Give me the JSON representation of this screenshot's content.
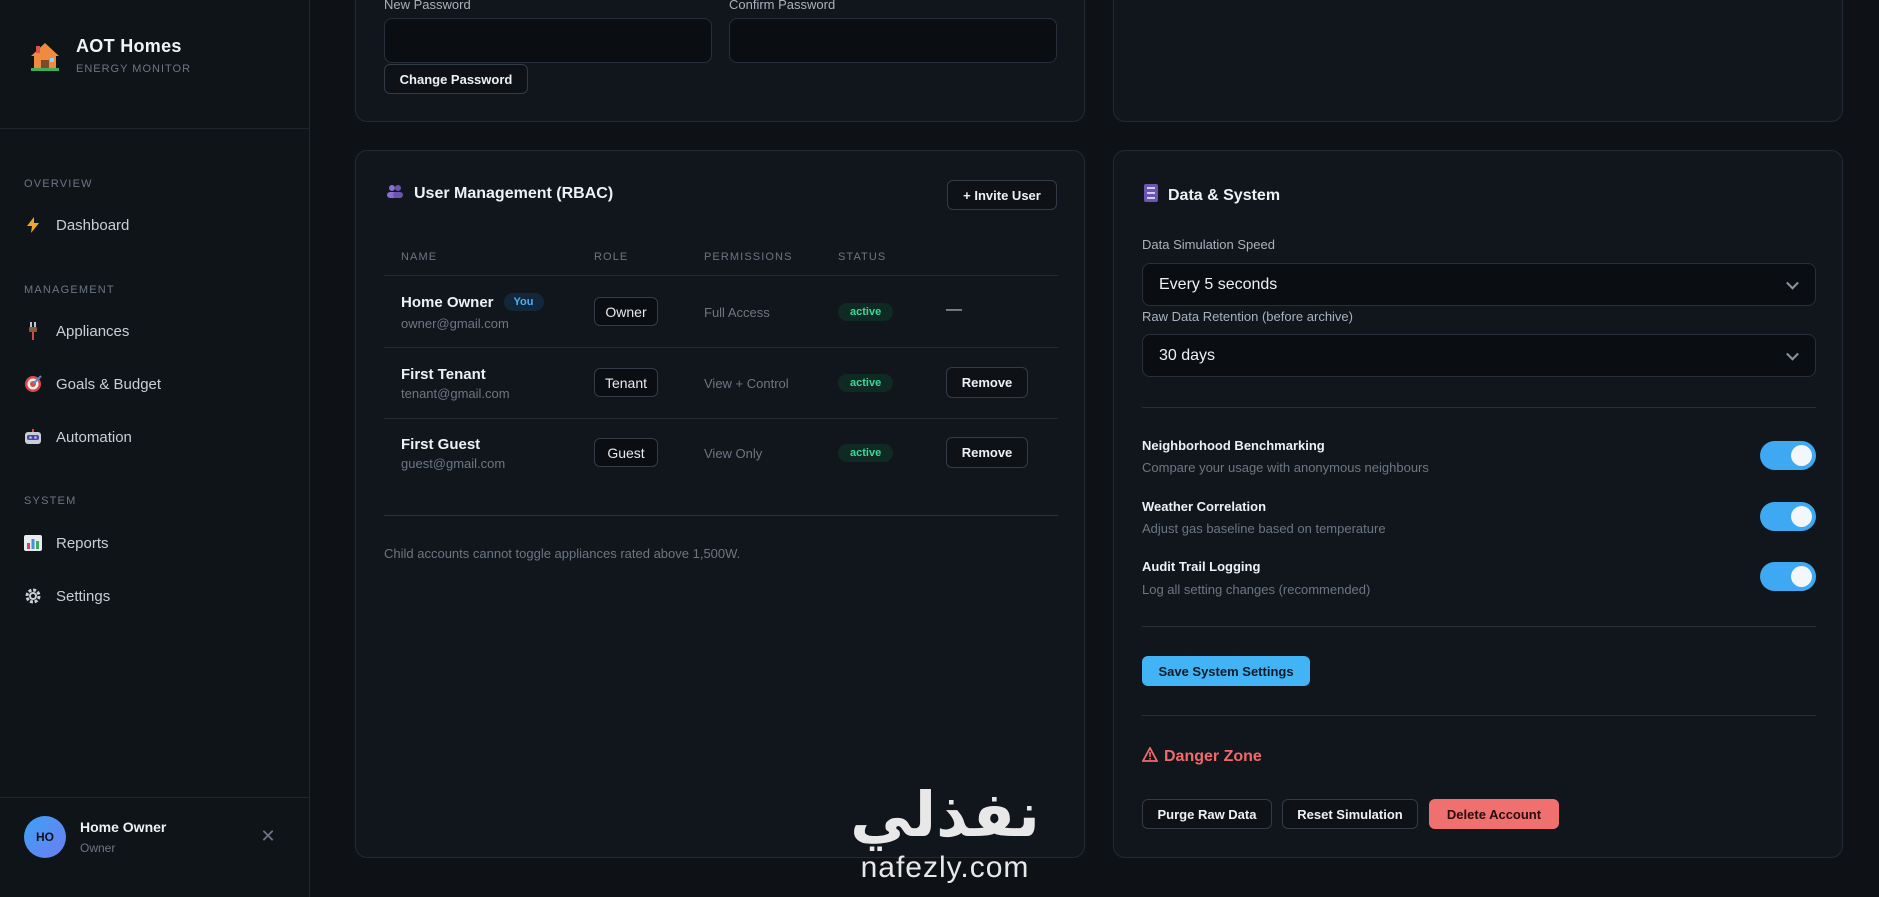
{
  "brand": {
    "title": "AOT Homes",
    "subtitle": "ENERGY MONITOR",
    "icon": "house-icon"
  },
  "sidebar": {
    "sections": {
      "overview": "OVERVIEW",
      "management": "MANAGEMENT",
      "system": "SYSTEM"
    },
    "items": [
      {
        "label": "Dashboard",
        "icon": "lightning-icon"
      },
      {
        "label": "Appliances",
        "icon": "plug-icon"
      },
      {
        "label": "Goals & Budget",
        "icon": "target-icon"
      },
      {
        "label": "Automation",
        "icon": "robot-icon"
      },
      {
        "label": "Reports",
        "icon": "bar-chart-icon"
      },
      {
        "label": "Settings",
        "icon": "gear-icon"
      }
    ],
    "user": {
      "initials": "HO",
      "name": "Home Owner",
      "role": "Owner"
    }
  },
  "password": {
    "new_label": "New Password",
    "confirm_label": "Confirm Password",
    "new_value": "",
    "confirm_value": "",
    "change_button": "Change Password"
  },
  "users": {
    "title": "User Management (RBAC)",
    "invite_button": "+ Invite User",
    "columns": [
      "NAME",
      "ROLE",
      "PERMISSIONS",
      "STATUS"
    ],
    "rows": [
      {
        "name": "Home Owner",
        "badge": "You",
        "email": "owner@gmail.com",
        "role": "Owner",
        "permissions": "Full Access",
        "status": "active",
        "action": "—"
      },
      {
        "name": "First Tenant",
        "email": "tenant@gmail.com",
        "role": "Tenant",
        "permissions": "View + Control",
        "status": "active",
        "action": "Remove"
      },
      {
        "name": "First Guest",
        "email": "guest@gmail.com",
        "role": "Guest",
        "permissions": "View Only",
        "status": "active",
        "action": "Remove"
      }
    ],
    "note": "Child accounts cannot toggle appliances rated above 1,500W."
  },
  "system": {
    "title": "Data & System",
    "speed_label": "Data Simulation Speed",
    "speed_value": "Every 5 seconds",
    "retention_label": "Raw Data Retention (before archive)",
    "retention_value": "30 days",
    "options": [
      {
        "title": "Neighborhood Benchmarking",
        "desc": "Compare your usage with anonymous neighbours",
        "on": true
      },
      {
        "title": "Weather Correlation",
        "desc": "Adjust gas baseline based on temperature",
        "on": true
      },
      {
        "title": "Audit Trail Logging",
        "desc": "Log all setting changes (recommended)",
        "on": true
      }
    ],
    "save_button": "Save System Settings",
    "danger_title": "Danger Zone",
    "purge_button": "Purge Raw Data",
    "reset_button": "Reset Simulation",
    "delete_button": "Delete Account"
  },
  "watermark": {
    "arabic": "نفذلي",
    "latin": "nafezly.com"
  },
  "colors": {
    "accent": "#42b4f5",
    "danger": "#f07070",
    "success": "#3ed69b",
    "background": "#0e1217"
  }
}
